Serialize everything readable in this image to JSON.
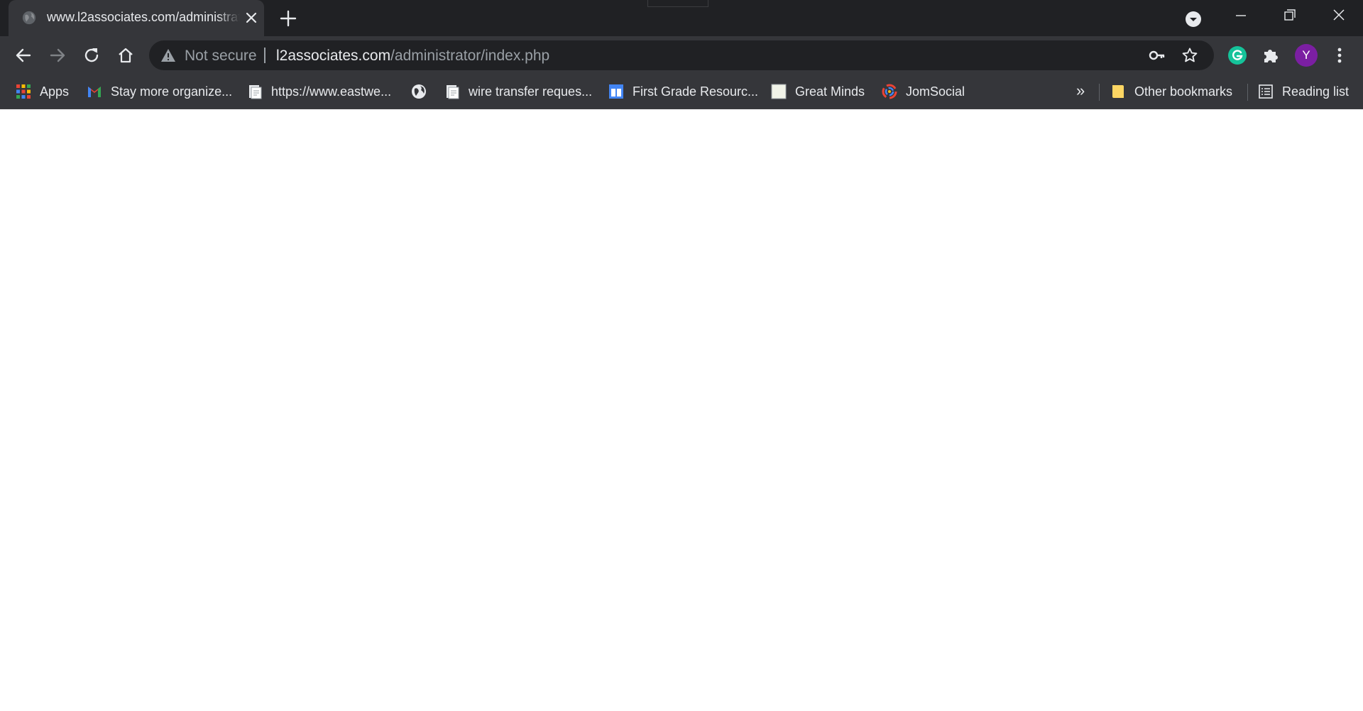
{
  "tab": {
    "title": "www.l2associates.com/administrator/index.php",
    "icon": "globe-icon"
  },
  "toolbar": {
    "security_label": "Not secure",
    "url_host": "l2associates.com",
    "url_path": "/administrator/index.php",
    "avatar_initial": "Y",
    "avatar_color": "#7b1fa2",
    "grammarly_color": "#15c39a"
  },
  "bookmarks": {
    "items": [
      {
        "label": "Apps",
        "icon": "apps-grid-icon"
      },
      {
        "label": "Stay more organize...",
        "icon": "gmail-icon"
      },
      {
        "label": "https://www.eastwe...",
        "icon": "document-icon"
      },
      {
        "label": "",
        "icon": "globe-icon"
      },
      {
        "label": "wire transfer reques...",
        "icon": "document-icon"
      },
      {
        "label": "First Grade Resourc...",
        "icon": "calendar-icon"
      },
      {
        "label": "Great Minds",
        "icon": "page-icon"
      },
      {
        "label": "JomSocial",
        "icon": "jomsocial-icon"
      }
    ],
    "overflow_label": "»",
    "other_bookmarks": "Other bookmarks",
    "reading_list": "Reading list"
  },
  "theme": {
    "frame": "#202124",
    "toolbar": "#35363a",
    "omnibox": "#202124",
    "text": "#e8eaed",
    "muted": "#9aa0a6",
    "page": "#ffffff"
  }
}
